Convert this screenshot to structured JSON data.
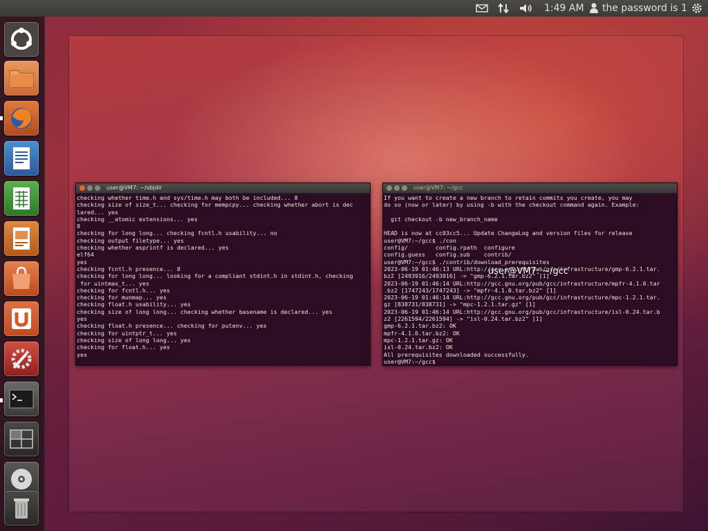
{
  "top_panel": {
    "clock": "1:49 AM",
    "user": "the password is 1"
  },
  "launcher": {
    "items": [
      {
        "name": "dash-home",
        "icon": "ubuntu-logo-icon"
      },
      {
        "name": "files",
        "icon": "folder-icon"
      },
      {
        "name": "firefox",
        "icon": "firefox-icon"
      },
      {
        "name": "writer",
        "icon": "libreoffice-writer-icon"
      },
      {
        "name": "calc",
        "icon": "libreoffice-calc-icon"
      },
      {
        "name": "impress",
        "icon": "libreoffice-impress-icon"
      },
      {
        "name": "software-center",
        "icon": "shopping-bag-icon"
      },
      {
        "name": "ubuntu-one",
        "icon": "ubuntu-one-icon"
      },
      {
        "name": "system-settings",
        "icon": "settings-wrench-icon"
      },
      {
        "name": "terminal",
        "icon": "terminal-icon"
      },
      {
        "name": "workspace-switcher",
        "icon": "workspace-icon"
      },
      {
        "name": "dvd",
        "icon": "disc-icon"
      },
      {
        "name": "trash",
        "icon": "trash-icon"
      }
    ]
  },
  "terminal_left": {
    "title": "user@VM7: ~/objdir",
    "text": "checking whether time.h and sys/time.h may both be included... 8\nchecking size of size_t... checking for mempcpy... checking whether abort is dec\nlared... yes\nchecking __atomic extensions... yes\n8\nchecking for long long... checking fcntl.h usability... no\nchecking output filetype... yes\nchecking whether asprintf is declared... yes\nelf64\nyes\nchecking fcntl.h presence... 8\nchecking for long long... looking for a compliant stdint.h in stdint.h, checking\n for uintmax_t... yes\nchecking for fcntl.h... yes\nchecking for munmap... yes\nchecking float.h usability... yes\nchecking size of long long... checking whether basename is declared... yes\nyes\nchecking float.h presence... checking for putenv... yes\nchecking for uintptr_t... yes\nchecking size of long long... yes\nchecking for float.h... yes\nyes"
  },
  "terminal_right": {
    "title": "user@VM7: ~/gcc",
    "text": "If you want to create a new branch to retain commits you create, you may\ndo so (now or later) by using -b with the checkout command again. Example:\n\n  git checkout -b new_branch_name\n\nHEAD is now at cc03cc5... Update ChangeLog and version files for release\nuser@VM7:~/gcc$ ./con\nconfig/        config.rpath  configure\nconfig.guess   config.sub    contrib/\nuser@VM7:~/gcc$ ./contrib/download_prerequisites\n2023-06-19 01:46:13 URL:http://gcc.gnu.org/pub/gcc/infrastructure/gmp-6.2.1.tar.\nbz2 [2493916/2493916] -> \"gmp-6.2.1.tar.bz2\" [1]\n2023-06-19 01:46:14 URL:http://gcc.gnu.org/pub/gcc/infrastructure/mpfr-4.1.0.tar\n.bz2 [1747243/1747243] -> \"mpfr-4.1.0.tar.bz2\" [1]\n2023-06-19 01:46:14 URL:http://gcc.gnu.org/pub/gcc/infrastructure/mpc-1.2.1.tar.\ngz [838731/838731] -> \"mpc-1.2.1.tar.gz\" [1]\n2023-06-19 01:46:14 URL:http://gcc.gnu.org/pub/gcc/infrastructure/isl-0.24.tar.b\nz2 [2261594/2261594] -> \"isl-0.24.tar.bz2\" [1]\ngmp-6.2.1.tar.bz2: OK\nmpfr-4.1.0.tar.bz2: OK\nmpc-1.2.1.tar.gz: OK\nisl-0.24.tar.bz2: OK\nAll prerequisites downloaded successfully.\nuser@VM7:~/gcc$ "
  },
  "tooltip": "user@VM7: ~/gcc",
  "colors": {
    "terminal_bg": "#2c0c22",
    "panel_bg": "#3c3b37",
    "close_button": "#e2663a"
  }
}
